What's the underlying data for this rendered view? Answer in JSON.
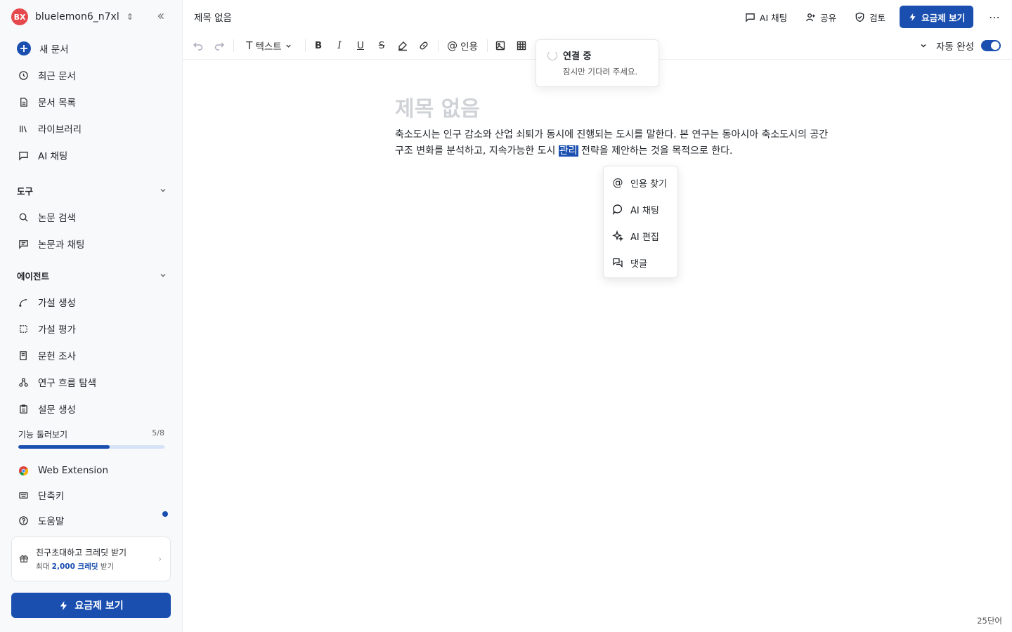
{
  "sidebar": {
    "workspace": {
      "initials": "BX",
      "name": "bluelemon6_n7xl"
    },
    "nav": [
      {
        "label": "새 문서",
        "icon": "plus-icon"
      },
      {
        "label": "최근 문서",
        "icon": "clock-icon"
      },
      {
        "label": "문서 목록",
        "icon": "document-icon"
      },
      {
        "label": "라이브러리",
        "icon": "library-icon"
      },
      {
        "label": "AI 채팅",
        "icon": "chat-icon"
      }
    ],
    "tools_header": "도구",
    "tools": [
      {
        "label": "논문 검색",
        "icon": "search-icon"
      },
      {
        "label": "논문과 채팅",
        "icon": "paper-chat-icon"
      }
    ],
    "agents_header": "에이전트",
    "agents": [
      {
        "label": "가설 생성",
        "icon": "hypothesis-icon"
      },
      {
        "label": "가설 평가",
        "icon": "evaluate-icon"
      },
      {
        "label": "문헌 조사",
        "icon": "literature-icon"
      },
      {
        "label": "연구 흐름 탐색",
        "icon": "flow-icon"
      },
      {
        "label": "설문 생성",
        "icon": "survey-icon"
      }
    ],
    "tour": {
      "label": "기능 둘러보기",
      "count": "5/8",
      "progress": 0.625
    },
    "bottom": [
      {
        "label": "Web Extension",
        "icon": "chrome-icon"
      },
      {
        "label": "단축키",
        "icon": "keyboard-icon"
      },
      {
        "label": "도움말",
        "icon": "help-icon"
      }
    ],
    "invite": {
      "title": "친구초대하고 크레딧 받기",
      "sub_prefix": "최대",
      "sub_highlight": "2,000 크레딧",
      "sub_suffix": "받기"
    },
    "plan_button": "요금제 보기"
  },
  "topbar": {
    "doc_title": "제목 없음",
    "ai_chat": "AI 채팅",
    "share": "공유",
    "review": "검토",
    "plan_button": "요금제 보기"
  },
  "toolbar": {
    "text_style": "텍스트",
    "cite": "인용",
    "autocomplete_label": "자동 완성",
    "autocomplete_on": true
  },
  "connecting": {
    "title": "연결 중",
    "subtitle": "잠시만 기다려 주세요."
  },
  "document": {
    "heading_placeholder": "제목 없음",
    "body_before": "축소도시는 인구 감소와 산업 쇠퇴가 동시에 진행되는 도시를 말한다. 본 연구는 동아시아 축소도시의 공간 구조 변화를 분석하고, 지속가능한 도시 ",
    "body_selected": "관리",
    "body_after": " 전략을 제안하는 것을 목적으로 한다."
  },
  "context_menu": [
    {
      "label": "인용 찾기",
      "icon": "at-icon"
    },
    {
      "label": "AI 채팅",
      "icon": "chat-bubble-icon"
    },
    {
      "label": "AI 편집",
      "icon": "sparkle-icon"
    },
    {
      "label": "댓글",
      "icon": "comment-icon"
    }
  ],
  "status": {
    "word_count": "25단어"
  },
  "colors": {
    "accent": "#1a4fb0",
    "avatar": "#e5484d"
  }
}
